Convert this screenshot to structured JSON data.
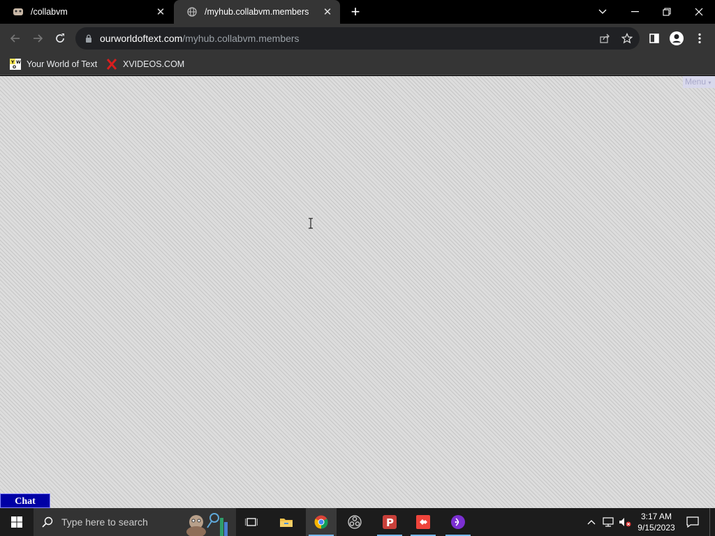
{
  "browser": {
    "tabs": [
      {
        "title": "/collabvm",
        "active": false
      },
      {
        "title": "/myhub.collabvm.members",
        "active": true
      }
    ],
    "url": {
      "domain": "ourworldoftext.com",
      "path": "/myhub.collabvm.members"
    },
    "bookmarks": [
      {
        "label": "Your World of Text",
        "icon": "yourworldoftext-icon"
      },
      {
        "label": "XVIDEOS.COM",
        "icon": "xvideos-icon"
      }
    ]
  },
  "page": {
    "menu_label": "Menu",
    "chat_label": "Chat"
  },
  "taskbar": {
    "search_placeholder": "Type here to search",
    "time": "3:17 AM",
    "date": "9/15/2023"
  },
  "colors": {
    "tab_active": "#353535",
    "chat_bg": "#0000a5",
    "page_bg": "#dddddd"
  }
}
